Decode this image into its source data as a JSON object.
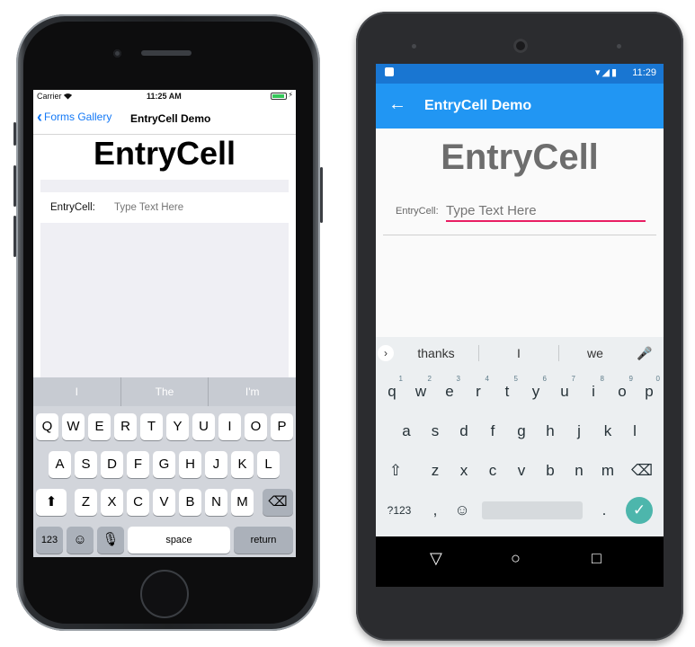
{
  "ios": {
    "status": {
      "carrier": "Carrier",
      "time": "11:25 AM"
    },
    "nav": {
      "back_label": "Forms Gallery",
      "title": "EntryCell Demo"
    },
    "heading": "EntryCell",
    "entry": {
      "label": "EntryCell:",
      "placeholder": "Type Text Here"
    },
    "keyboard": {
      "predictions": [
        "I",
        "The",
        "I'm"
      ],
      "row1": [
        "Q",
        "W",
        "E",
        "R",
        "T",
        "Y",
        "U",
        "I",
        "O",
        "P"
      ],
      "row2": [
        "A",
        "S",
        "D",
        "F",
        "G",
        "H",
        "J",
        "K",
        "L"
      ],
      "row3": [
        "Z",
        "X",
        "C",
        "V",
        "B",
        "N",
        "M"
      ],
      "numbers_key": "123",
      "space_key": "space",
      "return_key": "return"
    }
  },
  "android": {
    "status": {
      "time": "11:29"
    },
    "appbar": {
      "title": "EntryCell Demo"
    },
    "heading": "EntryCell",
    "entry": {
      "label": "EntryCell:",
      "placeholder": "Type Text Here"
    },
    "keyboard": {
      "suggestions": [
        "thanks",
        "I",
        "we"
      ],
      "row1": [
        "q",
        "w",
        "e",
        "r",
        "t",
        "y",
        "u",
        "i",
        "o",
        "p"
      ],
      "row1_hints": [
        "1",
        "2",
        "3",
        "4",
        "5",
        "6",
        "7",
        "8",
        "9",
        "0"
      ],
      "row2": [
        "a",
        "s",
        "d",
        "f",
        "g",
        "h",
        "j",
        "k",
        "l"
      ],
      "row3": [
        "z",
        "x",
        "c",
        "v",
        "b",
        "n",
        "m"
      ],
      "symbols_key": "?123",
      "comma_key": ",",
      "period_key": "."
    }
  },
  "colors": {
    "ios_tint": "#1479f6",
    "android_primary": "#2196f3",
    "android_primary_dark": "#1976d2",
    "android_accent": "#e91e63",
    "android_enter": "#4db6ac"
  }
}
